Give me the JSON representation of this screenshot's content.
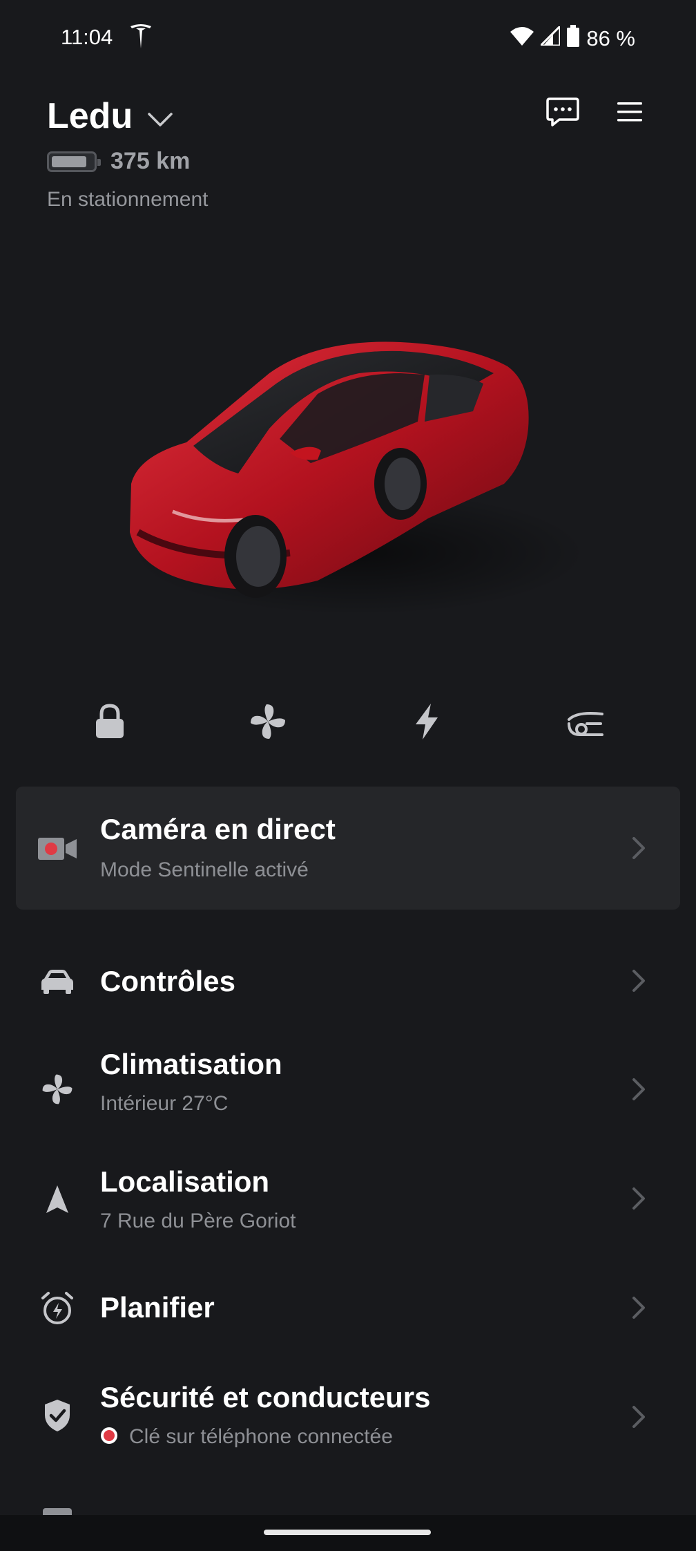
{
  "status_bar": {
    "time": "11:04",
    "battery_percent": "86 %"
  },
  "header": {
    "vehicle_name": "Ledu",
    "range": "375 km",
    "battery_level": 0.86,
    "park_status": "En stationnement"
  },
  "quick_controls": [
    "lock-icon",
    "fan-icon",
    "bolt-icon",
    "frunk-icon"
  ],
  "camera_card": {
    "title": "Caméra en direct",
    "subtitle": "Mode Sentinelle activé"
  },
  "menu": {
    "controls": {
      "title": "Contrôles"
    },
    "climate": {
      "title": "Climatisation",
      "subtitle": "Intérieur 27°C"
    },
    "location": {
      "title": "Localisation",
      "subtitle": "7 Rue du Père Goriot"
    },
    "schedule": {
      "title": "Planifier"
    },
    "security": {
      "title": "Sécurité et conducteurs",
      "subtitle": "Clé sur téléphone connectée"
    }
  },
  "colors": {
    "background": "#18191c",
    "card": "#252629",
    "accent_red": "#e03a44",
    "car_red": "#b3121f"
  }
}
